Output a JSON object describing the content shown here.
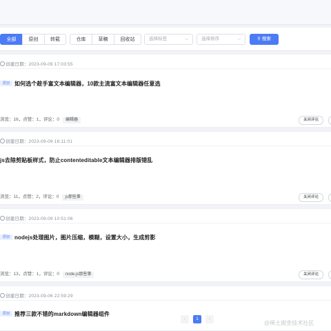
{
  "toolbar": {
    "tabs_group1": [
      "全部",
      "原创",
      "转载"
    ],
    "tabs_group2": [
      "仓库",
      "草稿",
      "回收站"
    ],
    "tag_select_placeholder": "选择标签",
    "sort_select_placeholder": "选择排序",
    "search_label": "搜索",
    "accent_color": "#4b7bf5"
  },
  "articles": [
    {
      "date_label": "创建日期：",
      "date": "2023-09-09 17:03:55",
      "badge": "原创",
      "title": "如何选个趁手富文本编辑器，10款主流富文本编辑器任意选",
      "stats": "浏览：16，点赞：1，评论：0",
      "tag": "编辑器",
      "close_comment": "关闭评论"
    },
    {
      "date_label": "创建日期：",
      "date": "2023-09-09 16:11:01",
      "badge": "",
      "title": "js去除剪贴板样式，防止contenteditable文本编辑器排版错乱",
      "stats": "浏览：11，点赞：2，评论：0",
      "tag": "js那些事",
      "close_comment": "关闭评论"
    },
    {
      "date_label": "创建日期：",
      "date": "2023-09-09 10:51:06",
      "badge": "原创",
      "title": "nodejs处理图片，图片压缩，模糊，设置大小，生成剪影",
      "stats": "浏览：13，点赞：1，评论：0",
      "tag": "node.js那些事",
      "close_comment": "关闭评论"
    },
    {
      "date_label": "创建日期：",
      "date": "2023-09-06 22:59:29",
      "badge": "原创",
      "title": "推荐三款不错的markdown编辑器组件"
    }
  ],
  "pagination": {
    "prev": "‹",
    "current": "1",
    "next": "›"
  },
  "watermark": "@稀土掘金技术社区"
}
